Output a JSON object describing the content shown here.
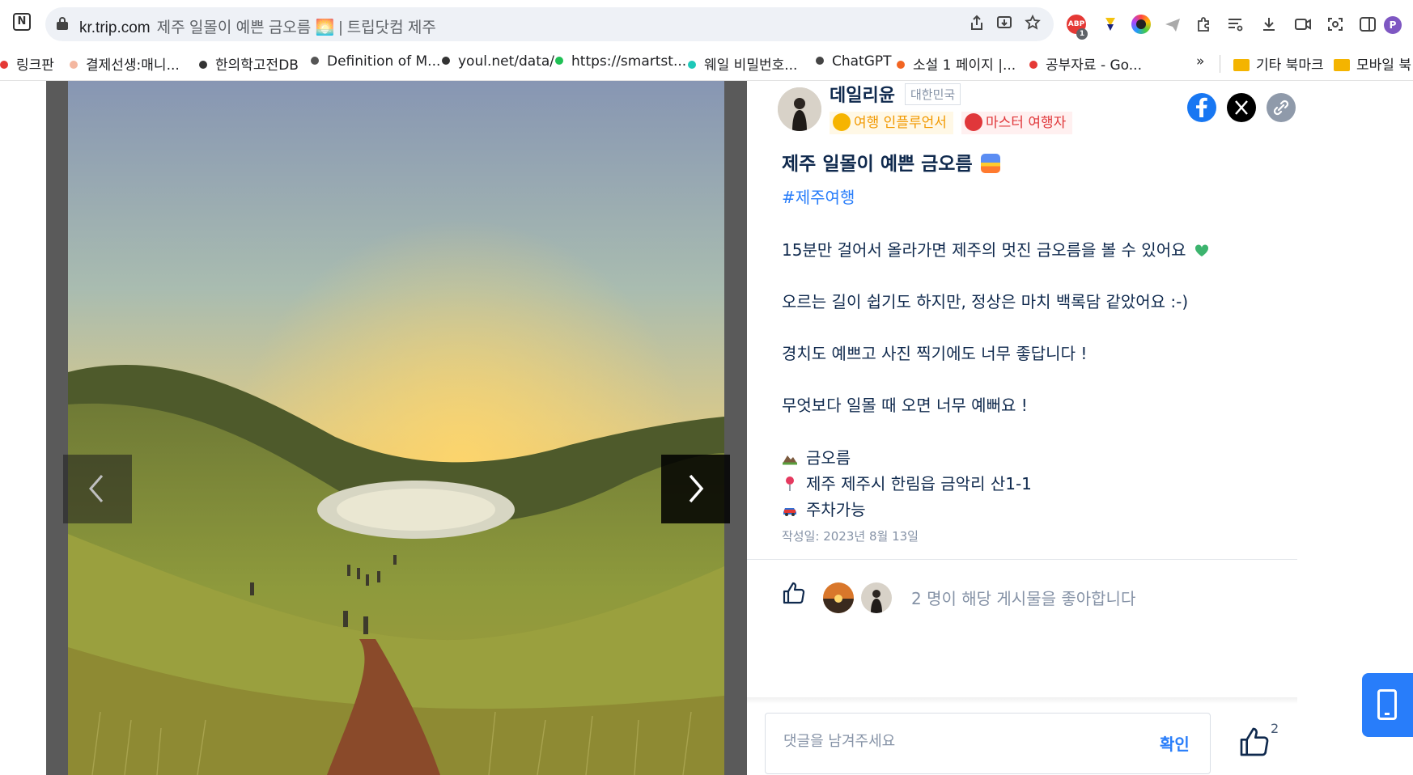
{
  "browser": {
    "url_host": "kr.trip.com",
    "page_title": "제주 일몰이 예쁜 금오름 🌅 | 트립닷컴 제주",
    "extension_badge": "1",
    "profile_initial": "P"
  },
  "bookmarks": [
    {
      "label": "링크판",
      "color": "#e53935"
    },
    {
      "label": "결제선생:매니...",
      "color": "#f4b7a0"
    },
    {
      "label": "한의학고전DB",
      "color": "#333333"
    },
    {
      "label": "Definition of M...",
      "color": "#555555"
    },
    {
      "label": "youl.net/data/",
      "color": "#333333"
    },
    {
      "label": "https://smartst...",
      "color": "#20c055"
    },
    {
      "label": "웨일 비밀번호...",
      "color": "#1ec8b8"
    },
    {
      "label": "ChatGPT",
      "color": "#444444"
    },
    {
      "label": "소설 1 페이지 |...",
      "color": "#f26522"
    },
    {
      "label": "공부자료 - Go...",
      "color": "#e53935"
    }
  ],
  "bookmarks_overflow": "»",
  "bookmark_folders": [
    "기타 북마크",
    "모바일 북"
  ],
  "post": {
    "author": "데일리윤",
    "country": "대한민국",
    "badge_influencer": "여행 인플루언서",
    "badge_master": "마스터 여행자",
    "title": "제주 일몰이 예쁜 금오름",
    "hashtag": "#제주여행",
    "paragraphs": [
      "15분만 걸어서 올라가면 제주의 멋진 금오름을 볼 수 있어요",
      "오르는 길이 쉽기도 하지만, 정상은 마치 백록담 같았어요 :-)",
      "경치도 예쁘고 사진 찍기에도 너무 좋답니다 !",
      "무엇보다 일몰 때 오면 너무 예뻐요 !"
    ],
    "info": [
      {
        "icon": "mountain-icon",
        "text": "금오름"
      },
      {
        "icon": "pin-icon",
        "text": "제주 제주시 한림읍 금악리 산1-1"
      },
      {
        "icon": "car-icon",
        "text": "주차가능"
      }
    ],
    "date": "작성일: 2023년 8월 13일",
    "likes_text": "2 명이 해당 게시물을 좋아합니다",
    "like_count": "2"
  },
  "comment": {
    "placeholder": "댓글을 남겨주세요",
    "submit": "확인"
  },
  "colors": {
    "brand_blue": "#287dfa",
    "text_dark": "#0f294d",
    "text_grey": "#8592a6",
    "influencer_gold": "#f29900",
    "master_red": "#e0373a",
    "facebook": "#1877f2"
  }
}
